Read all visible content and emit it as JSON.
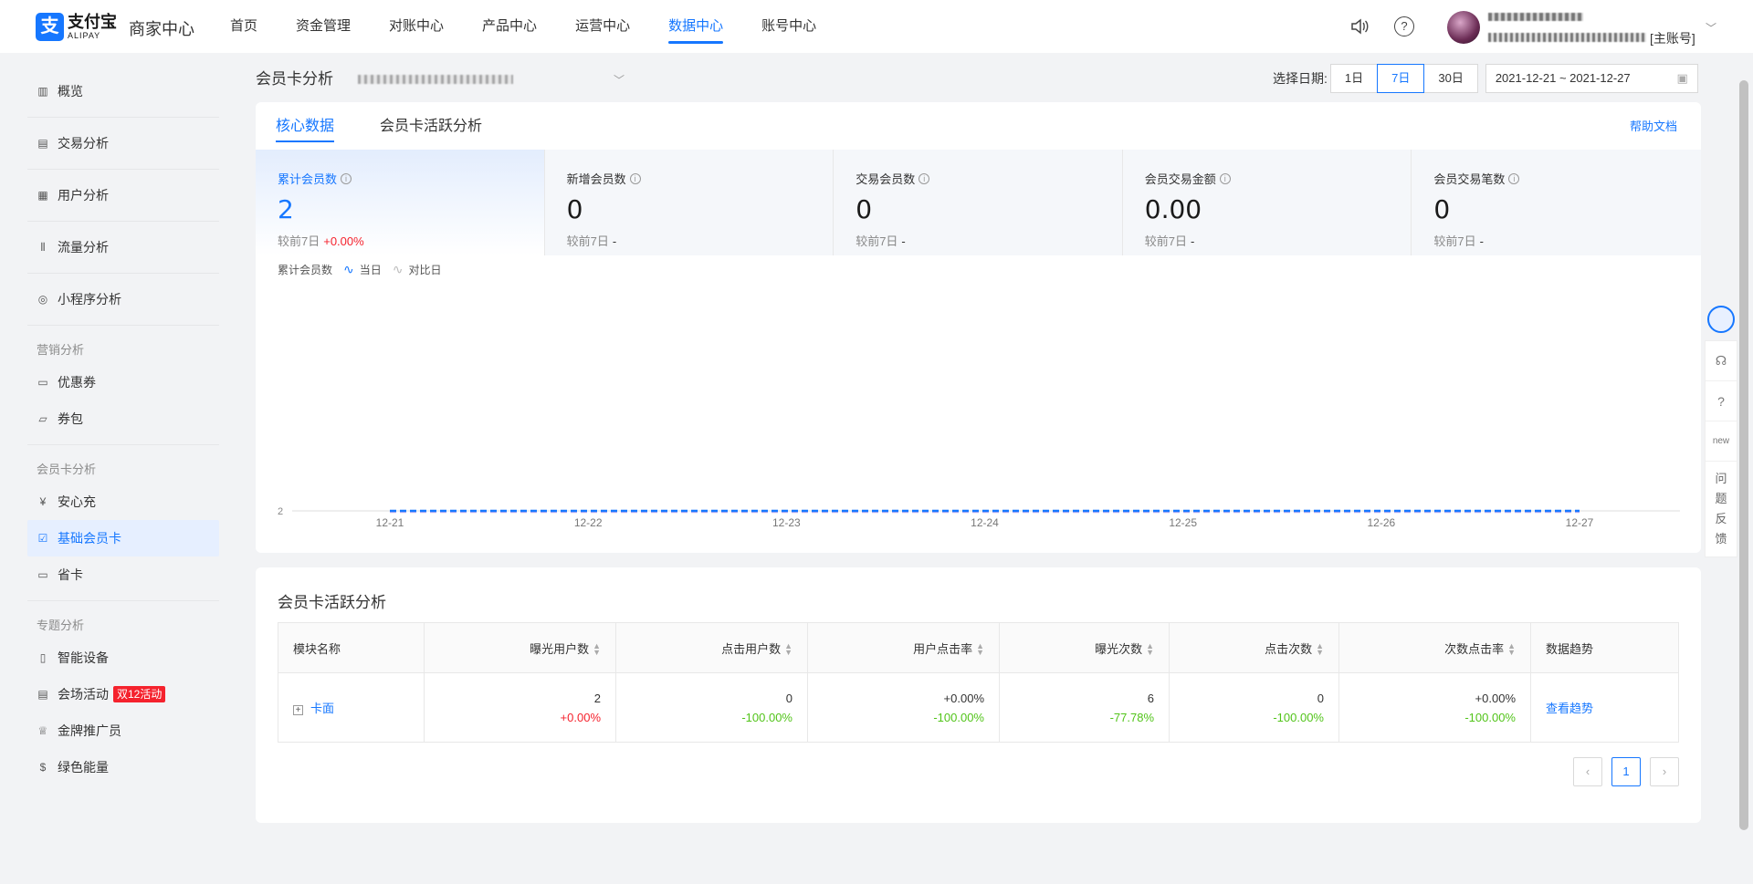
{
  "header": {
    "logo_mark": "支",
    "logo_cn": "支付宝",
    "logo_en": "ALIPAY",
    "merchant_center": "商家中心",
    "nav": [
      "首页",
      "资金管理",
      "对账中心",
      "产品中心",
      "运营中心",
      "数据中心",
      "账号中心"
    ],
    "active_nav": "数据中心",
    "account_tag": "[主账号]"
  },
  "sidebar": {
    "items_top": [
      {
        "label": "概览",
        "icon": "bar-chart-icon"
      },
      {
        "label": "交易分析",
        "icon": "trend-chart-icon"
      },
      {
        "label": "用户分析",
        "icon": "user-doc-icon"
      },
      {
        "label": "流量分析",
        "icon": "candlestick-icon"
      },
      {
        "label": "小程序分析",
        "icon": "mini-program-icon"
      }
    ],
    "group_marketing": "营销分析",
    "items_marketing": [
      {
        "label": "优惠券",
        "icon": "coupon-icon"
      },
      {
        "label": "券包",
        "icon": "wallet-icon"
      }
    ],
    "group_member": "会员卡分析",
    "items_member": [
      {
        "label": "安心充",
        "icon": "yen-circle-icon"
      },
      {
        "label": "基础会员卡",
        "icon": "member-card-icon",
        "active": true
      },
      {
        "label": "省卡",
        "icon": "card-icon"
      }
    ],
    "group_topic": "专题分析",
    "items_topic": [
      {
        "label": "智能设备",
        "icon": "device-icon"
      },
      {
        "label": "会场活动",
        "icon": "event-icon",
        "badge": "双12活动"
      },
      {
        "label": "金牌推广员",
        "icon": "trophy-icon"
      },
      {
        "label": "绿色能量",
        "icon": "energy-icon"
      }
    ]
  },
  "page": {
    "title": "会员卡分析",
    "date_label": "选择日期:",
    "date_options": [
      "1日",
      "7日",
      "30日"
    ],
    "date_selected": "7日",
    "date_range": "2021-12-21 ~ 2021-12-27"
  },
  "panel1": {
    "tabs": [
      "核心数据",
      "会员卡活跃分析"
    ],
    "active_tab": "核心数据",
    "help_link": "帮助文档",
    "metrics": [
      {
        "label": "累计会员数",
        "value": "2",
        "compare_label": "较前7日",
        "compare": "+0.00%",
        "active": true
      },
      {
        "label": "新增会员数",
        "value": "0",
        "compare_label": "较前7日",
        "compare": "-"
      },
      {
        "label": "交易会员数",
        "value": "0",
        "compare_label": "较前7日",
        "compare": "-"
      },
      {
        "label": "会员交易金额",
        "value": "0.00",
        "compare_label": "较前7日",
        "compare": "-"
      },
      {
        "label": "会员交易笔数",
        "value": "0",
        "compare_label": "较前7日",
        "compare": "-"
      }
    ]
  },
  "chart_data": {
    "type": "line",
    "title": "累计会员数",
    "x": [
      "12-21",
      "12-22",
      "12-23",
      "12-24",
      "12-25",
      "12-26",
      "12-27"
    ],
    "series": [
      {
        "name": "当日",
        "values": [
          2,
          2,
          2,
          2,
          2,
          2,
          2
        ],
        "color": "#1677ff"
      },
      {
        "name": "对比日",
        "values": [
          2,
          2,
          2,
          2,
          2,
          2,
          2
        ],
        "color": "#c8b6f0"
      }
    ],
    "yticks": [
      "2"
    ],
    "grid": false,
    "legend_position": "top-left"
  },
  "panel2": {
    "title": "会员卡活跃分析",
    "columns": [
      "模块名称",
      "曝光用户数",
      "点击用户数",
      "用户点击率",
      "曝光次数",
      "点击次数",
      "次数点击率",
      "数据趋势"
    ],
    "rows": [
      {
        "expand": "+",
        "name": "卡面",
        "exposure_users": {
          "value": "2",
          "change": "+0.00%"
        },
        "click_users": {
          "value": "0",
          "change": "-100.00%"
        },
        "user_ctr": {
          "value": "+0.00%",
          "change": "-100.00%"
        },
        "exposure_times": {
          "value": "6",
          "change": "-77.78%"
        },
        "click_times": {
          "value": "0",
          "change": "-100.00%"
        },
        "times_ctr": {
          "value": "+0.00%",
          "change": "-100.00%"
        },
        "trend": "查看趋势"
      }
    ],
    "pager": {
      "prev": "‹",
      "current": "1",
      "next": "›"
    }
  },
  "floatbar": {
    "feedback_chars": [
      "问",
      "题",
      "反",
      "馈"
    ],
    "new_label": "new",
    "help_label": "?"
  }
}
